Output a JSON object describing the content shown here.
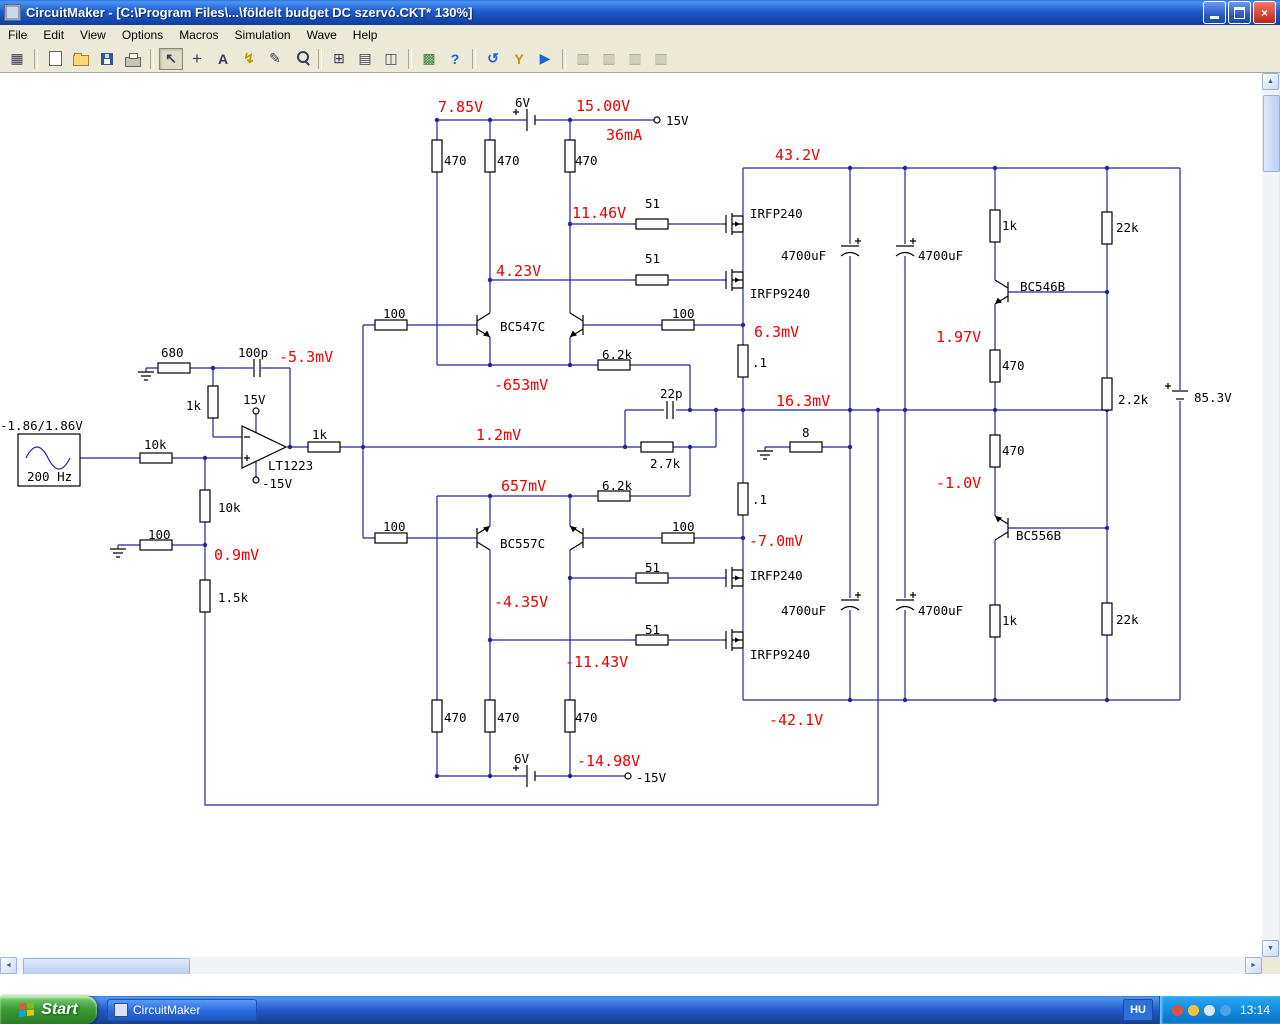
{
  "window": {
    "title": "CircuitMaker - [C:\\Program Files\\...\\földelt budget DC szervó.CKT* 130%]",
    "close_glyph": "×"
  },
  "menubar": {
    "items": [
      {
        "label": "File"
      },
      {
        "label": "Edit"
      },
      {
        "label": "View"
      },
      {
        "label": "Options"
      },
      {
        "label": "Macros"
      },
      {
        "label": "Simulation"
      },
      {
        "label": "Wave"
      },
      {
        "label": "Help"
      }
    ]
  },
  "toolbar": {
    "buttons": [
      {
        "name": "part-browser",
        "glyph": "▦"
      },
      {
        "name": "new-file",
        "glyph": ""
      },
      {
        "name": "open-file",
        "glyph": ""
      },
      {
        "name": "save-file",
        "glyph": ""
      },
      {
        "name": "print",
        "glyph": ""
      },
      {
        "name": "select-tool",
        "glyph": "↖",
        "pressed": true
      },
      {
        "name": "wire-tool",
        "glyph": "+"
      },
      {
        "name": "text-tool",
        "glyph": "A"
      },
      {
        "name": "delete-tool",
        "glyph": "↯"
      },
      {
        "name": "probe-tool",
        "glyph": "✎"
      },
      {
        "name": "zoom-tool",
        "glyph": ""
      },
      {
        "name": "fit-to-page",
        "glyph": "⊞"
      },
      {
        "name": "sheet-view",
        "glyph": "▤"
      },
      {
        "name": "split-view",
        "glyph": "◫"
      },
      {
        "name": "mixed-mode",
        "glyph": "▩"
      },
      {
        "name": "help-tool",
        "glyph": "?"
      },
      {
        "name": "reset-simulation",
        "glyph": "↺"
      },
      {
        "name": "probe-y",
        "glyph": "Y"
      },
      {
        "name": "run-simulation",
        "glyph": "▶"
      },
      {
        "name": "scope-window-1",
        "glyph": "▥",
        "disabled": true
      },
      {
        "name": "scope-window-2",
        "glyph": "▥",
        "disabled": true
      },
      {
        "name": "scope-window-3",
        "glyph": "▥",
        "disabled": true
      },
      {
        "name": "scope-window-4",
        "glyph": "▥",
        "disabled": true
      }
    ]
  },
  "scrollbar": {
    "up": "▲",
    "down": "▼",
    "left": "◄",
    "right": "►"
  },
  "schematic": {
    "red_labels": [
      "7.85V",
      "15.00V",
      "36mA",
      "43.2V",
      "11.46V",
      "4.23V",
      "-5.3mV",
      "6.3mV",
      "1.97V",
      "-653mV",
      "16.3mV",
      "1.2mV",
      "657mV",
      "-1.0V",
      "-7.0mV",
      "0.9mV",
      "-4.35V",
      "-11.43V",
      "-42.1V",
      "-14.98V"
    ],
    "black_labels": [
      "6V",
      "15V",
      "470",
      "470",
      "470",
      "51",
      "IRFP240",
      "51",
      "IRFP9240",
      "4700uF",
      "4700uF",
      "1k",
      "22k",
      "BC546B",
      "100",
      "BC547C",
      "100",
      "6.2k",
      ".1",
      "680",
      "100p",
      "1k",
      "15V",
      "LT1223",
      "-15V",
      "-1.86/1.86V",
      "200 Hz",
      "10k",
      "1k",
      "10k",
      "100",
      "1.5k",
      "22p",
      "2.7k",
      "8",
      "470",
      "2.2k",
      "85.3V",
      "6.2k",
      ".1",
      "100",
      "BC557C",
      "100",
      "51",
      "IRFP240",
      "51",
      "IRFP9240",
      "4700uF",
      "4700uF",
      "470",
      "BC556B",
      "1k",
      "22k",
      "470",
      "470",
      "470",
      "6V",
      "-15V"
    ],
    "colors": {
      "wire": "#2323a0",
      "annotation": "#ee0000",
      "component": "#000000"
    }
  },
  "taskbar": {
    "start_label": "Start",
    "task_button_label": "CircuitMaker",
    "tray": {
      "language": "HU",
      "clock": "13:14"
    }
  }
}
